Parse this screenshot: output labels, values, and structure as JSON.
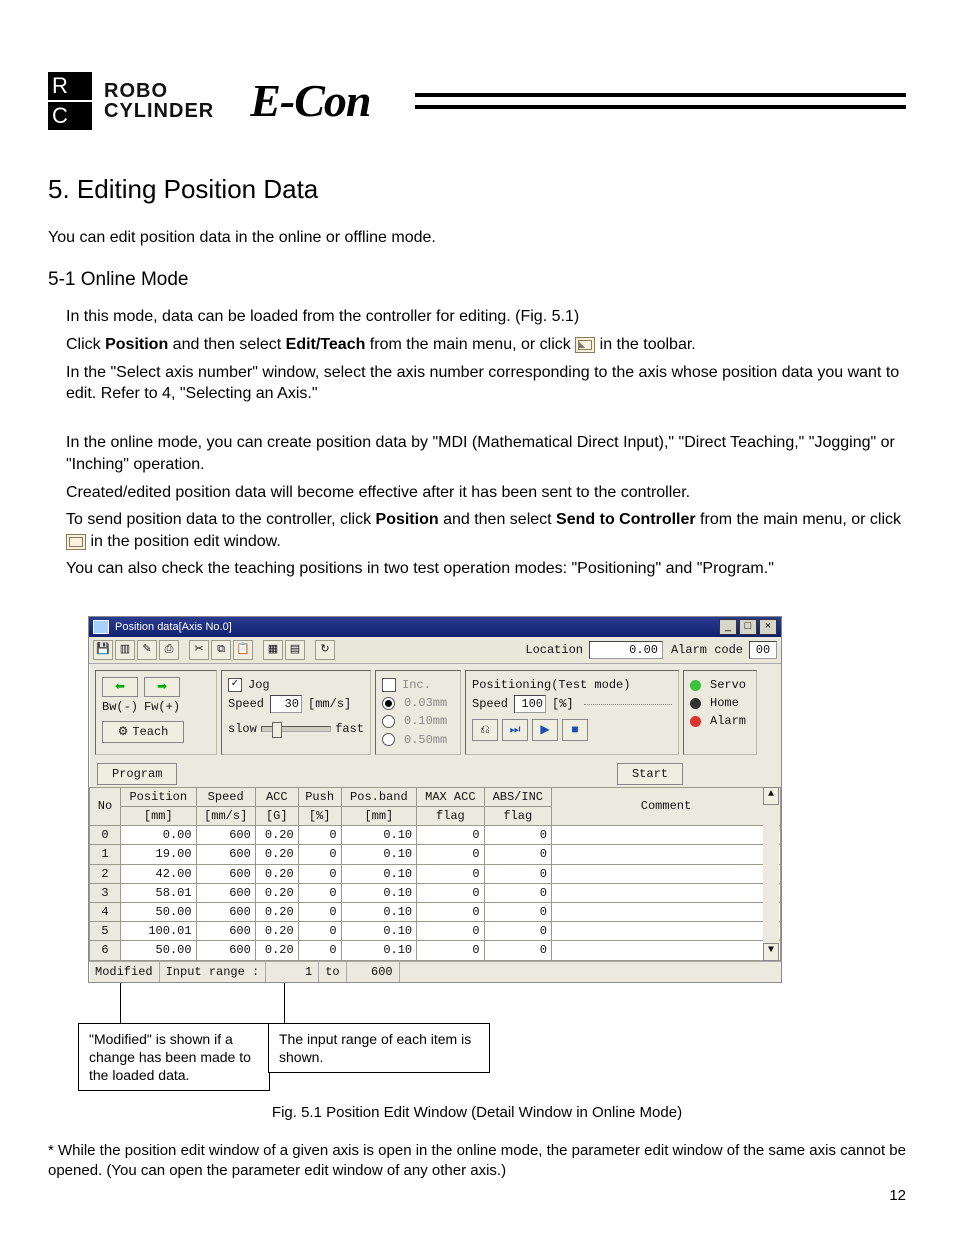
{
  "header": {
    "rc_line1": "ROBO",
    "rc_line2": "CYLINDER",
    "econ": "E-Con"
  },
  "section": {
    "h1": "5.  Editing Position Data",
    "intro": "You can edit position data in the online or offline mode.",
    "h2": "5-1   Online Mode",
    "p1a": "In this mode, data can be loaded from the controller for editing. (Fig. 5.1)",
    "p1b_pre": "Click ",
    "p1b_b1": "Position",
    "p1b_mid": " and then select ",
    "p1b_b2": "Edit/Teach",
    "p1b_post": " from the main menu, or click ",
    "p1b_tail": " in the toolbar.",
    "p1c": "In the \"Select axis number\" window, select the axis number corresponding to the axis whose position data you want to edit. Refer to 4, \"Selecting an Axis.\"",
    "p2a": "In the online mode, you can create position data by \"MDI (Mathematical Direct Input),\" \"Direct Teaching,\" \"Jogging\" or \"Inching\" operation.",
    "p2b": "Created/edited position data will become effective after it has been sent to the controller.",
    "p2c_pre": "To send position data to the controller, click ",
    "p2c_b1": "Position",
    "p2c_mid": " and then select ",
    "p2c_b2": "Send to Controller",
    "p2c_post": " from the main menu, or click ",
    "p2c_tail": " in the position edit window.",
    "p2d": "You can also check the teaching positions in two test operation modes: \"Positioning\" and \"Program.\""
  },
  "app": {
    "title": "Position data[Axis No.0]",
    "location_lbl": "Location",
    "location_val": "0.00",
    "alarm_lbl": "Alarm code",
    "alarm_val": "00",
    "jog": {
      "bw": "Bw(-)",
      "fw": "Fw(+)",
      "teach": "Teach",
      "jog_chk": "Jog",
      "speed_lbl": "Speed",
      "speed_val": "30",
      "speed_unit": "[mm/s]",
      "slow": "slow",
      "fast": "fast"
    },
    "inc": {
      "lbl": "Inc.",
      "o1": "0.03mm",
      "o2": "0.10mm",
      "o3": "0.50mm"
    },
    "test": {
      "title": "Positioning(Test mode)",
      "speed_lbl": "Speed",
      "speed_val": "100",
      "speed_unit": "[%]"
    },
    "leds": {
      "servo": "Servo",
      "home": "Home",
      "alarm": "Alarm"
    },
    "program_btn": "Program",
    "start_btn": "Start",
    "cols": {
      "no": "No",
      "pos1": "Position",
      "pos2": "[mm]",
      "spd1": "Speed",
      "spd2": "[mm/s]",
      "acc1": "ACC",
      "acc2": "[G]",
      "push1": "Push",
      "push2": "[%]",
      "pb1": "Pos.band",
      "pb2": "[mm]",
      "mx1": "MAX ACC",
      "mx2": "flag",
      "ai1": "ABS/INC",
      "ai2": "flag",
      "cmt": "Comment"
    },
    "rows": [
      {
        "no": "0",
        "pos": "0.00",
        "spd": "600",
        "acc": "0.20",
        "push": "0",
        "pb": "0.10",
        "mx": "0",
        "ai": "0"
      },
      {
        "no": "1",
        "pos": "19.00",
        "spd": "600",
        "acc": "0.20",
        "push": "0",
        "pb": "0.10",
        "mx": "0",
        "ai": "0"
      },
      {
        "no": "2",
        "pos": "42.00",
        "spd": "600",
        "acc": "0.20",
        "push": "0",
        "pb": "0.10",
        "mx": "0",
        "ai": "0"
      },
      {
        "no": "3",
        "pos": "58.01",
        "spd": "600",
        "acc": "0.20",
        "push": "0",
        "pb": "0.10",
        "mx": "0",
        "ai": "0"
      },
      {
        "no": "4",
        "pos": "50.00",
        "spd": "600",
        "acc": "0.20",
        "push": "0",
        "pb": "0.10",
        "mx": "0",
        "ai": "0"
      },
      {
        "no": "5",
        "pos": "100.01",
        "spd": "600",
        "acc": "0.20",
        "push": "0",
        "pb": "0.10",
        "mx": "0",
        "ai": "0"
      },
      {
        "no": "6",
        "pos": "50.00",
        "spd": "600",
        "acc": "0.20",
        "push": "0",
        "pb": "0.10",
        "mx": "0",
        "ai": "0"
      }
    ],
    "status": {
      "mod": "Modified",
      "range_lbl": "Input range :",
      "range_from": "1",
      "range_to_lbl": "to",
      "range_to": "600"
    }
  },
  "callouts": {
    "modified": "\"Modified\" is shown if a change has been made to the loaded data.",
    "range": "The input range of each item is shown."
  },
  "figure_caption": "Fig. 5.1    Position Edit Window (Detail Window in Online Mode)",
  "footnote": "*  While the position edit window of a given axis is open in the online mode, the parameter edit window of the same axis cannot be opened. (You can open the parameter edit window of any other axis.)",
  "page_number": "12"
}
